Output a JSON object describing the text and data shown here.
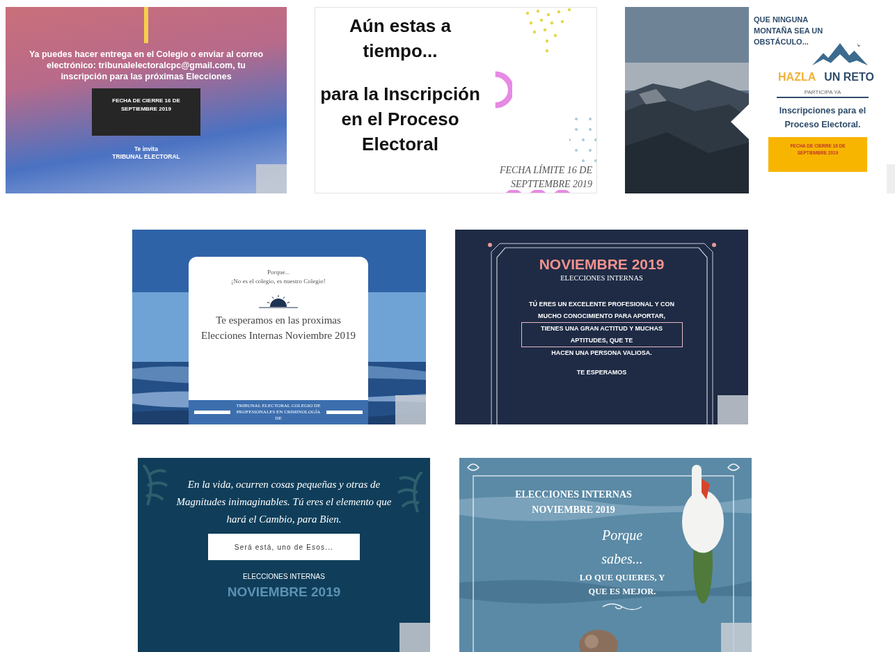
{
  "gallery": [
    {
      "kind": "gradient",
      "message": "Ya puedes hacer entrega en el Colegio o enviar al correo electrónico: tribunalelectoralcpc@gmail.com, tu inscripción para las próximas Elecciones",
      "date_box": "FECHA DE CIERRE 16 DE SEPTIEMBRE 2019",
      "footer": [
        "Te invita",
        "TRIBUNAL ELECTORAL"
      ]
    },
    {
      "kind": "confetti",
      "headline": "Aún estas a tiempo...",
      "subline": "para la Inscripción en el Proceso Electoral",
      "deadline": "FECHA LÍMITE 16 DE SEPTTEMBRE 2019"
    },
    {
      "kind": "mountain",
      "tagline": "QUE NINGUNA MONTAÑA SEA UN OBSTÁCULO...",
      "accent": "HAZLA",
      "challenge": "UN RETO",
      "caption": "PARTICIPA YA",
      "message": "Inscripciones para el Proceso Electoral.",
      "date_box": "FECHA DE CIERRE 16 DE SEPTIEMBRE 2019"
    },
    {
      "kind": "sea",
      "intro": "Porque...",
      "quote": "¡No es el colegio, es nuestro Colegio!",
      "message": "Te esperamos en las proximas Elecciones Internas Noviembre 2019",
      "footer": "TRIBUNAL ELECTORAL COLEGIO DE PROFESIONALES EN CRIMINOLOGÍA DE"
    },
    {
      "kind": "frame",
      "title": "NOVIEMBRE 2019",
      "subtitle": "ELECCIONES INTERNAS",
      "paragraphs": [
        {
          "text": "TÚ ERES UN EXCELENTE PROFESIONAL Y CON MUCHO CONOCIMIENTO PARA APORTAR,",
          "boxed": false
        },
        {
          "text": "TIENES UNA GRAN ACTITUD Y MUCHAS APTITUDES, QUE TE",
          "boxed": true
        },
        {
          "text": "HACEN UNA PERSONA VALIOSA.",
          "boxed": false
        }
      ],
      "closing": "TE ESPERAMOS"
    },
    {
      "kind": "leaves",
      "message": "En la vida, ocurren cosas pequeñas y otras de Magnitudes inimaginables. Tú eres el elemento que hará el Cambio, para Bien.",
      "button": "Será está, uno de Esos...",
      "subtitle": "ELECCIONES INTERNAS",
      "title": "NOVIEMBRE 2019"
    },
    {
      "kind": "swan",
      "title": "ELECCIONES INTERNAS NOVIEMBRE 2019",
      "script": "Porque sabes...",
      "message": "LO QUE QUIERES, Y QUE ES MEJOR."
    }
  ]
}
